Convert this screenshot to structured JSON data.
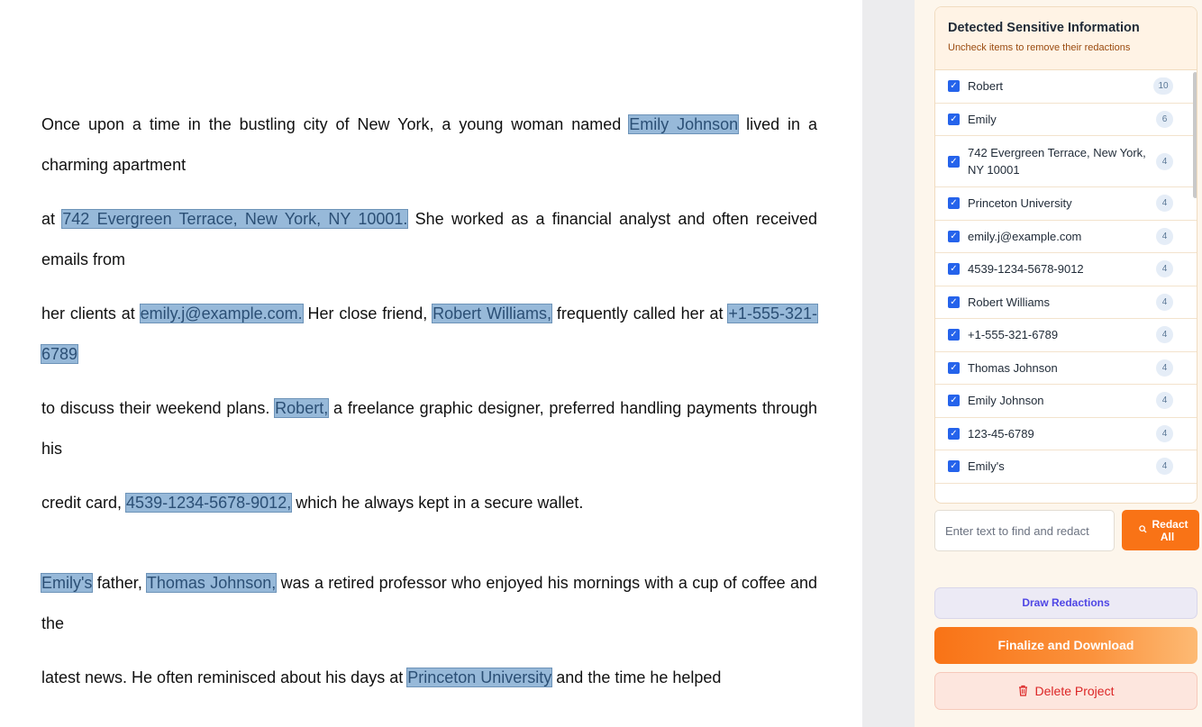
{
  "document": {
    "paragraphs": [
      [
        {
          "t": "Once upon a time in the bustling city of New York, a young woman named "
        },
        {
          "t": "Emily Johnson",
          "r": true
        },
        {
          "t": " lived in a charming apartment"
        }
      ],
      [
        {
          "t": "at "
        },
        {
          "t": "742 Evergreen Terrace, New York, NY 10001.",
          "r": true
        },
        {
          "t": " She worked as a financial analyst and often received emails from"
        }
      ],
      [
        {
          "t": "her clients at "
        },
        {
          "t": "emily.j@example.com.",
          "r": true
        },
        {
          "t": " Her close friend, "
        },
        {
          "t": "Robert Williams,",
          "r": true
        },
        {
          "t": " frequently called her at "
        },
        {
          "t": "+1-555-321-6789",
          "r": true
        }
      ],
      [
        {
          "t": "to discuss their weekend plans. "
        },
        {
          "t": "Robert,",
          "r": true
        },
        {
          "t": " a freelance graphic designer, preferred handling payments through his"
        }
      ],
      [
        {
          "t": "credit card, "
        },
        {
          "t": "4539-1234-5678-9012,",
          "r": true
        },
        {
          "t": " which he always kept in a secure wallet."
        }
      ],
      [
        {
          "t": "Emily's",
          "r": true
        },
        {
          "t": " father, "
        },
        {
          "t": "Thomas Johnson,",
          "r": true
        },
        {
          "t": " was a retired professor who enjoyed his mornings with a cup of coffee and the"
        }
      ],
      [
        {
          "t": "latest news. He often reminisced about his days at "
        },
        {
          "t": "Princeton University",
          "r": true
        },
        {
          "t": " and the time he helped"
        }
      ]
    ]
  },
  "sidebar": {
    "title": "Detected Sensitive Information",
    "subtitle": "Uncheck items to remove their redactions",
    "items": [
      {
        "label": "Robert",
        "count": "10",
        "checked": true
      },
      {
        "label": "Emily",
        "count": "6",
        "checked": true
      },
      {
        "label": "742 Evergreen Terrace, New York, NY 10001",
        "count": "4",
        "checked": true
      },
      {
        "label": "Princeton University",
        "count": "4",
        "checked": true
      },
      {
        "label": "emily.j@example.com",
        "count": "4",
        "checked": true
      },
      {
        "label": "4539-1234-5678-9012",
        "count": "4",
        "checked": true
      },
      {
        "label": "Robert Williams",
        "count": "4",
        "checked": true
      },
      {
        "label": "+1-555-321-6789",
        "count": "4",
        "checked": true
      },
      {
        "label": "Thomas Johnson",
        "count": "4",
        "checked": true
      },
      {
        "label": "Emily Johnson",
        "count": "4",
        "checked": true
      },
      {
        "label": "123-45-6789",
        "count": "4",
        "checked": true
      },
      {
        "label": "Emily's",
        "count": "4",
        "checked": true
      }
    ],
    "find_placeholder": "Enter text to find and redact",
    "redact_all_label": "Redact All",
    "draw_label": "Draw Redactions",
    "finalize_label": "Finalize and Download",
    "delete_label": "Delete Project",
    "icons": {
      "search": "search-icon",
      "checkbox": "checkbox-checked-icon",
      "trash": "trash-icon"
    },
    "colors": {
      "accent": "#f97316",
      "redaction": "#97b9d9",
      "checkbox": "#2563eb",
      "danger": "#dc2626",
      "draw": "#4f46e5"
    }
  }
}
